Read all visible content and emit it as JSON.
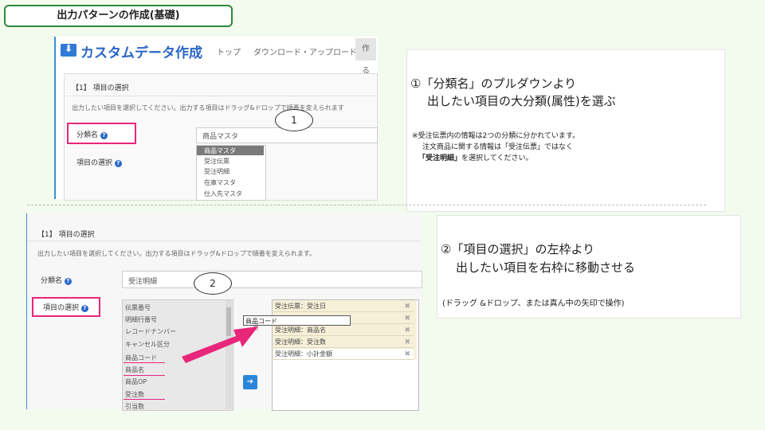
{
  "slide": {
    "title": "出力パターンの作成(基礎)"
  },
  "shot1": {
    "logo_text": "カスタムデータ作成",
    "nav": [
      "トップ",
      "ダウンロード・アップロード",
      "作る"
    ],
    "section_title": "【1】 項目の選択",
    "help_text": "出力したい項目を選択してください。出力する項目はドラッグ&ドロップで順番を変えられます",
    "category_label": "分類名",
    "items_label": "項目の選択",
    "select_value": "商品マスタ",
    "options": [
      "商品マスタ",
      "受注伝票",
      "受注明細",
      "在庫マスタ",
      "仕入先マスタ"
    ],
    "callout": "1"
  },
  "desc1": {
    "heading_line1": "①「分類名」のプルダウンより",
    "heading_line2": "出したい項目の大分類(属性)を選ぶ",
    "note_line1": "※受注伝票内の情報は2つの分類に分かれています。",
    "note_line2": "注文商品に関する情報は「受注伝票」ではなく",
    "note_line3_bold": "「受注明細」",
    "note_line3_rest": "を選択してください。"
  },
  "shot2": {
    "section_title": "【1】 項目の選択",
    "help_text": "出力したい項目を選択してください。出力する項目はドラッグ&ドロップで順番を変えられます。",
    "category_label": "分類名",
    "category_value": "受注明細",
    "items_label": "項目の選択",
    "callout": "2",
    "left_items": [
      "伝票番号",
      "明細行番号",
      "レコードナンバー",
      "キャンセル区分",
      "商品コード",
      "商品名",
      "商品OP",
      "受注数",
      "引当数"
    ],
    "right_items": [
      "受注伝票：受注日",
      "",
      "受注明細：商品名",
      "受注明細：受注数",
      "受注明細：小計金額"
    ],
    "drag_label": "商品コード",
    "arrow_glyph": "➔"
  },
  "desc2": {
    "heading_line1": "②「項目の選択」の左枠より",
    "heading_line2": "出したい項目を右枠に移動させる",
    "note": "(ドラッグ &ドロップ、または真ん中の矢印で操作)"
  },
  "colors": {
    "accent_pink": "#e8267a",
    "accent_blue": "#2a66c8",
    "title_border": "#2e8b3a"
  }
}
